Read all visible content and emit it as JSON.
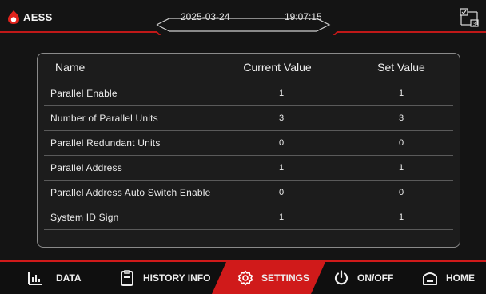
{
  "header": {
    "brand": "AESS",
    "date": "2025-03-24",
    "time": "19:07:15",
    "accent_color": "#d01a1a",
    "status_icon": "parallel-units-icon"
  },
  "table": {
    "columns": [
      "Name",
      "Current Value",
      "Set Value"
    ],
    "rows": [
      {
        "name": "Parallel Enable",
        "current": "1",
        "set": "1"
      },
      {
        "name": "Number of Parallel Units",
        "current": "3",
        "set": "3"
      },
      {
        "name": "Parallel Redundant Units",
        "current": "0",
        "set": "0"
      },
      {
        "name": "Parallel Address",
        "current": "1",
        "set": "1"
      },
      {
        "name": "Parallel Address Auto Switch Enable",
        "current": "0",
        "set": "0"
      },
      {
        "name": "System ID Sign",
        "current": "1",
        "set": "1"
      }
    ]
  },
  "nav": {
    "items": [
      {
        "label": "DATA",
        "icon": "bar-chart-icon"
      },
      {
        "label": "HISTORY INFO",
        "icon": "clipboard-icon"
      },
      {
        "label": "SETTINGS",
        "icon": "gear-icon",
        "active": true
      },
      {
        "label": "ON/OFF",
        "icon": "power-icon"
      },
      {
        "label": "HOME",
        "icon": "home-icon"
      }
    ],
    "active_color": "#d01a1a"
  }
}
